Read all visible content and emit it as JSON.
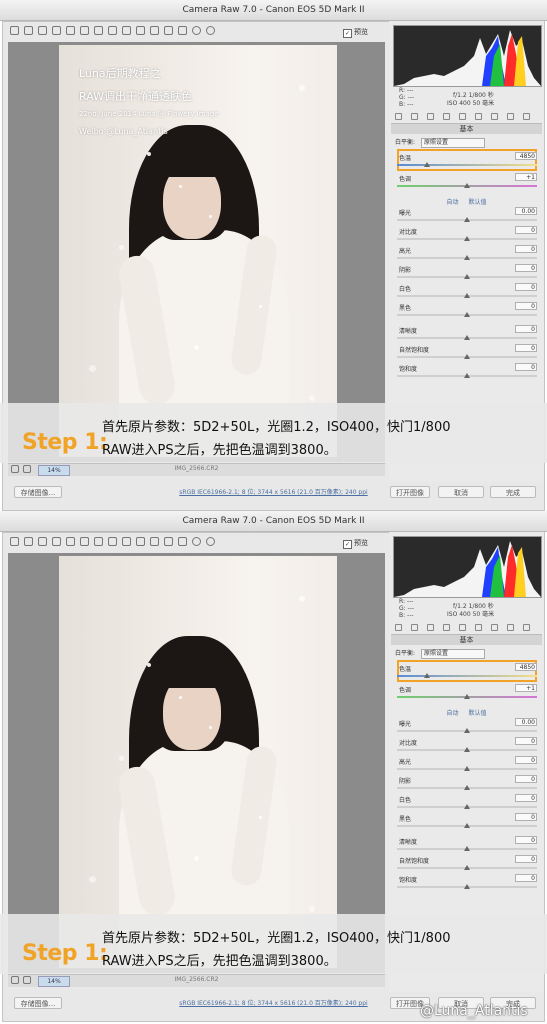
{
  "panels": [
    {
      "window_title": "Camera Raw 7.0 - Canon EOS 5D Mark II",
      "preview_label": "预览",
      "overlay": {
        "line1": "Luna后期教程之",
        "line2": "RAW调出干净通透肤色",
        "line3": "22nd, June 2014    Luna  @ Flowery Image",
        "line4": "Weibo @Luna_Atlantis"
      },
      "zoom_value": "14%",
      "filename": "IMG_2566.CR2",
      "workflow_link": "sRGB IEC61966-2.1; 8 位; 3744 x 5616 (21.0 百万像素); 240 ppi",
      "buttons": {
        "save": "存储图像...",
        "open": "打开图像",
        "cancel": "取消",
        "done": "完成"
      },
      "readout": {
        "r": "R: ---",
        "g": "G: ---",
        "b": "B: ---",
        "exposure": "f/1.2   1/800 秒",
        "iso": "ISO 400   50 毫米"
      },
      "section_title": "基本",
      "white_balance_label": "白平衡:",
      "white_balance_value": "原照设置",
      "temp": {
        "label": "色温",
        "value": "4850",
        "pos": 0.2
      },
      "tint": {
        "label": "色调",
        "value": "+1",
        "pos": 0.5
      },
      "auto_label": "自动",
      "default_label": "默认值",
      "sliders": [
        {
          "label": "曝光",
          "value": "0.00",
          "pos": 0.5
        },
        {
          "label": "对比度",
          "value": "0",
          "pos": 0.5
        },
        {
          "label": "高光",
          "value": "0",
          "pos": 0.5
        },
        {
          "label": "阴影",
          "value": "0",
          "pos": 0.5
        },
        {
          "label": "白色",
          "value": "0",
          "pos": 0.5
        },
        {
          "label": "黑色",
          "value": "0",
          "pos": 0.5
        },
        {
          "label": "清晰度",
          "value": "0",
          "pos": 0.5
        },
        {
          "label": "自然饱和度",
          "value": "0",
          "pos": 0.5
        },
        {
          "label": "饱和度",
          "value": "0",
          "pos": 0.5
        }
      ],
      "caption": {
        "step": "Step 1:",
        "line1": "首先原片参数：5D2+50L，光圈1.2，ISO400，快门1/800",
        "line2": "RAW进入PS之后，先把色温调到3800。"
      }
    },
    {
      "window_title": "Camera Raw 7.0 - Canon EOS 5D Mark II",
      "preview_label": "预览",
      "zoom_value": "14%",
      "filename": "IMG_2566.CR2",
      "workflow_link": "sRGB IEC61966-2.1; 8 位; 3744 x 5616 (21.0 百万像素); 240 ppi",
      "buttons": {
        "save": "存储图像...",
        "open": "打开图像",
        "cancel": "取消",
        "done": "完成"
      },
      "readout": {
        "r": "R: ---",
        "g": "G: ---",
        "b": "B: ---",
        "exposure": "f/1.2   1/800 秒",
        "iso": "ISO 400   50 毫米"
      },
      "section_title": "基本",
      "white_balance_label": "白平衡:",
      "white_balance_value": "原照设置",
      "temp": {
        "label": "色温",
        "value": "4850",
        "pos": 0.2
      },
      "tint": {
        "label": "色调",
        "value": "+1",
        "pos": 0.5
      },
      "auto_label": "自动",
      "default_label": "默认值",
      "sliders": [
        {
          "label": "曝光",
          "value": "0.00",
          "pos": 0.5
        },
        {
          "label": "对比度",
          "value": "0",
          "pos": 0.5
        },
        {
          "label": "高光",
          "value": "0",
          "pos": 0.5
        },
        {
          "label": "阴影",
          "value": "0",
          "pos": 0.5
        },
        {
          "label": "白色",
          "value": "0",
          "pos": 0.5
        },
        {
          "label": "黑色",
          "value": "0",
          "pos": 0.5
        },
        {
          "label": "清晰度",
          "value": "0",
          "pos": 0.5
        },
        {
          "label": "自然饱和度",
          "value": "0",
          "pos": 0.5
        },
        {
          "label": "饱和度",
          "value": "0",
          "pos": 0.5
        }
      ],
      "caption": {
        "step": "Step 1:",
        "line1": "首先原片参数：5D2+50L，光圈1.2，ISO400，快门1/800",
        "line2": "RAW进入PS之后，先把色温调到3800。"
      }
    }
  ],
  "watermark": "@Luna_Atlantis",
  "colors": {
    "accent_orange": "#f0a326",
    "panel_bg": "#e8e8e8",
    "canvas_bg": "#8b8b8b"
  }
}
